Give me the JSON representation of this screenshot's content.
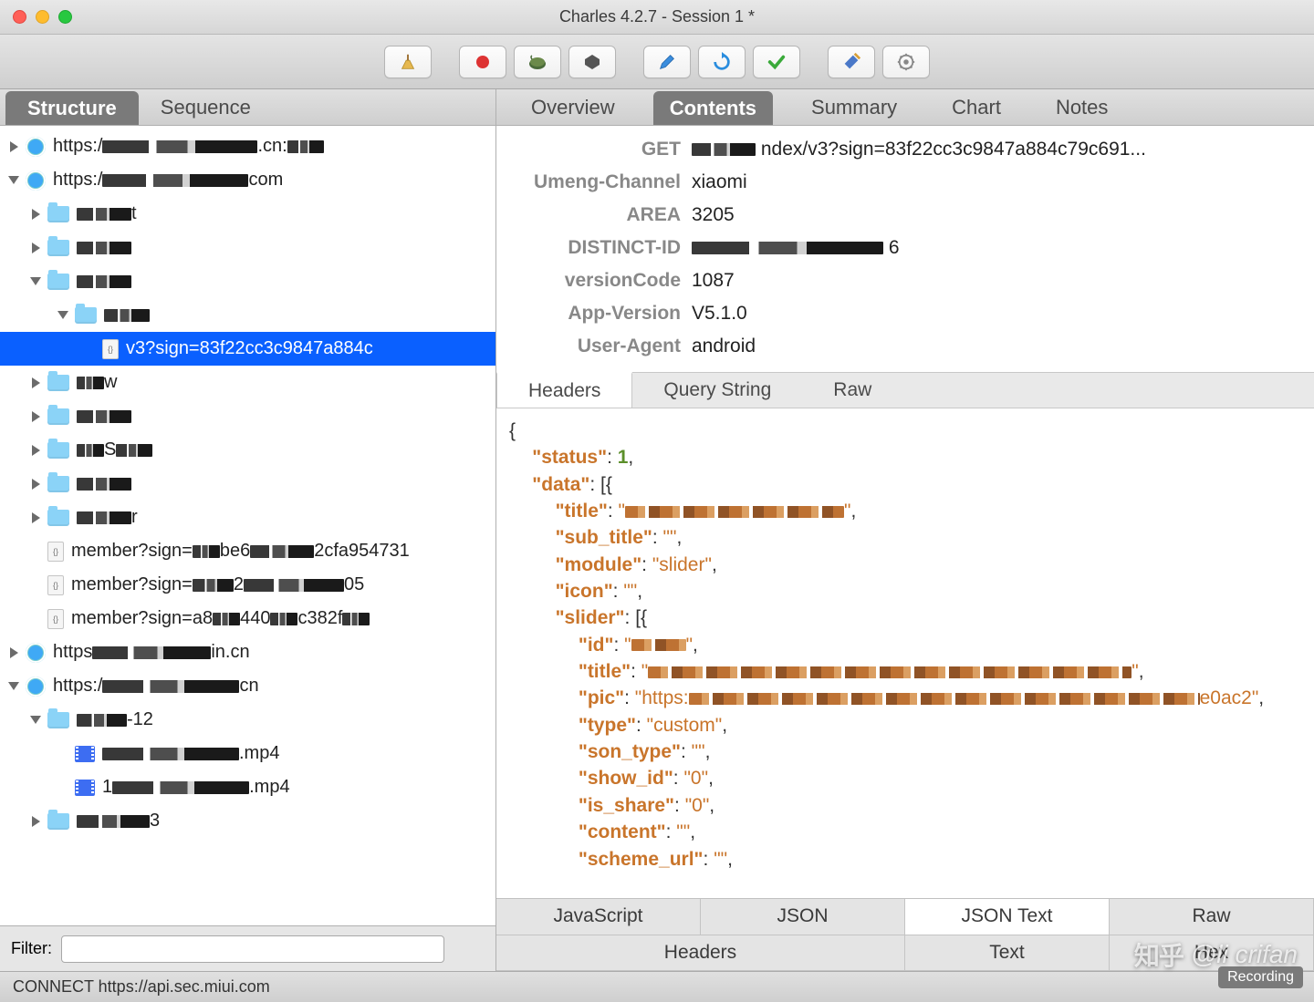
{
  "window": {
    "title": "Charles 4.2.7 - Session 1 *"
  },
  "toolbar_icons": [
    "broom",
    "record",
    "throttle",
    "breakpoints",
    "compose",
    "repeat",
    "validate",
    "tools",
    "settings"
  ],
  "left_tabs": [
    "Structure",
    "Sequence"
  ],
  "left_active_tab": "Structure",
  "tree": [
    {
      "level": 0,
      "disclosure": "closed",
      "icon": "globe",
      "label_pre": "https:/",
      "censor_w": 170,
      "label_post": ".cn:",
      "censor_tail_w": 40
    },
    {
      "level": 0,
      "disclosure": "open",
      "icon": "globe",
      "label_pre": "https:/",
      "censor_w": 160,
      "label_post": "com"
    },
    {
      "level": 1,
      "disclosure": "closed",
      "icon": "folder",
      "label_pre": "",
      "censor_w": 60,
      "label_post": "t"
    },
    {
      "level": 1,
      "disclosure": "closed",
      "icon": "folder",
      "label_pre": "",
      "censor_w": 60,
      "label_post": ""
    },
    {
      "level": 1,
      "disclosure": "open",
      "icon": "folder",
      "label_pre": "",
      "censor_w": 60,
      "label_post": ""
    },
    {
      "level": 2,
      "disclosure": "open",
      "icon": "folder",
      "label_pre": "",
      "censor_w": 50,
      "label_post": ""
    },
    {
      "level": 3,
      "disclosure": "none",
      "icon": "doc",
      "label": "v3?sign=83f22cc3c9847a884c",
      "selected": true
    },
    {
      "level": 1,
      "disclosure": "closed",
      "icon": "folder",
      "label_pre": "",
      "censor_w": 30,
      "label_post": "w"
    },
    {
      "level": 1,
      "disclosure": "closed",
      "icon": "folder",
      "label_pre": "",
      "censor_w": 60,
      "label_post": ""
    },
    {
      "level": 1,
      "disclosure": "closed",
      "icon": "folder",
      "label_pre": "",
      "censor_w": 30,
      "label_post": "S",
      "censor_tail_w": 40
    },
    {
      "level": 1,
      "disclosure": "closed",
      "icon": "folder",
      "label_pre": "",
      "censor_w": 60,
      "label_post": ""
    },
    {
      "level": 1,
      "disclosure": "closed",
      "icon": "folder",
      "label_pre": "",
      "censor_w": 60,
      "label_post": "r"
    },
    {
      "level": 1,
      "disclosure": "none",
      "icon": "doc",
      "label_pre": "member?sign=",
      "censor_w": 30,
      "label_mid": "be6",
      "censor_mid_w": 70,
      "label_post": "2cfa954731"
    },
    {
      "level": 1,
      "disclosure": "none",
      "icon": "doc",
      "label_pre": "member?sign=",
      "censor_w": 45,
      "label_mid": "2",
      "censor_mid_w": 110,
      "label_post": "05"
    },
    {
      "level": 1,
      "disclosure": "none",
      "icon": "doc",
      "label_pre": "member?sign=a8",
      "censor_w": 30,
      "label_mid": "440",
      "censor_mid_w": 30,
      "label_mid2": "c3",
      "censor_tail_w": 30,
      "label_post": "82f"
    },
    {
      "level": 0,
      "disclosure": "closed",
      "icon": "globe",
      "label_pre": "https",
      "censor_w": 130,
      "label_post": "in.cn"
    },
    {
      "level": 0,
      "disclosure": "open",
      "icon": "globe",
      "label_pre": "https:/",
      "censor_w": 150,
      "label_post": "cn"
    },
    {
      "level": 1,
      "disclosure": "open",
      "icon": "folder",
      "label_pre": "",
      "censor_w": 55,
      "label_mid": "-1",
      "label_post": "2"
    },
    {
      "level": 2,
      "disclosure": "none",
      "icon": "video",
      "label_pre": "",
      "censor_w": 150,
      "label_post": ".mp4"
    },
    {
      "level": 2,
      "disclosure": "none",
      "icon": "video",
      "label_pre": "1",
      "censor_w": 150,
      "label_post": ".mp4"
    },
    {
      "level": 1,
      "disclosure": "closed",
      "icon": "folder",
      "label_pre": "",
      "censor_w": 80,
      "label_post": "3"
    }
  ],
  "filter": {
    "label": "Filter:",
    "value": ""
  },
  "top_tabs": [
    "Overview",
    "Contents",
    "Summary",
    "Chart",
    "Notes"
  ],
  "top_active_tab": "Contents",
  "headers": [
    {
      "key": "GET",
      "val": "ndex/v3?sign=83f22cc3c9847a884c79c691...",
      "has_censor": true,
      "censor_w": 70
    },
    {
      "key": "Umeng-Channel",
      "val": "xiaomi"
    },
    {
      "key": "AREA",
      "val": "3205"
    },
    {
      "key": "DISTINCT-ID",
      "val": "",
      "has_censor": true,
      "censor_w": 210,
      "val_post": "6"
    },
    {
      "key": "versionCode",
      "val": "1087"
    },
    {
      "key": "App-Version",
      "val": "V5.1.0"
    },
    {
      "key": "User-Agent",
      "val": "android"
    }
  ],
  "mid_tabs": [
    "Headers",
    "Query String",
    "Raw"
  ],
  "mid_active_tab": "Headers",
  "json_body": {
    "status": 1,
    "data_fields": [
      {
        "key": "title",
        "censor_w": 240
      },
      {
        "key": "sub_title",
        "value": ""
      },
      {
        "key": "module",
        "value": "slider"
      },
      {
        "key": "icon",
        "value": ""
      }
    ],
    "slider_fields": [
      {
        "key": "id",
        "censor_w": 60
      },
      {
        "key": "title",
        "censor_w": 530
      },
      {
        "key": "pic",
        "prefix": "https:",
        "censor_w": 560,
        "suffix": "e0ac2"
      },
      {
        "key": "type",
        "value": "custom"
      },
      {
        "key": "son_type",
        "value": ""
      },
      {
        "key": "show_id",
        "value": "0"
      },
      {
        "key": "is_share",
        "value": "0"
      },
      {
        "key": "content",
        "value": ""
      },
      {
        "key": "scheme_url",
        "value": ""
      }
    ]
  },
  "bottom_tabs_row1": [
    "JavaScript",
    "JSON",
    "JSON Text",
    "Raw"
  ],
  "bottom_tabs_row2": [
    "Headers",
    "Text",
    "Hex"
  ],
  "bottom_active_tab": "JSON Text",
  "status": {
    "text": "CONNECT https://api.sec.miui.com",
    "recording": "Recording"
  },
  "watermark": {
    "logo": "知乎",
    "text": "@li crifan"
  }
}
